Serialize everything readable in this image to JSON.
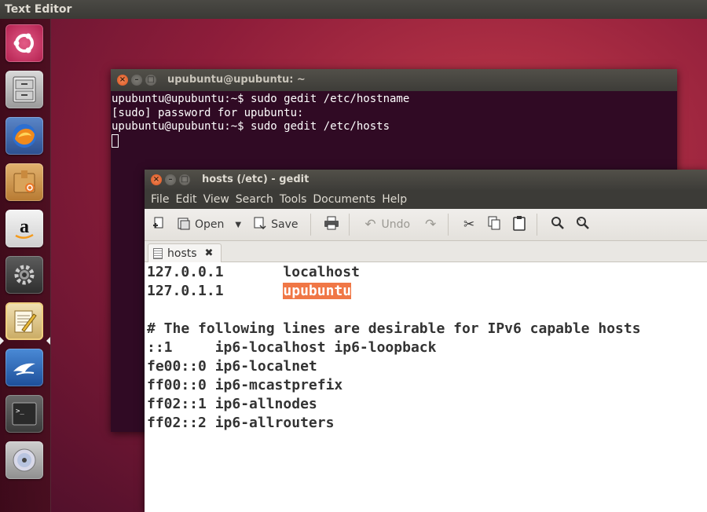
{
  "panel": {
    "title": "Text Editor"
  },
  "launcher": {
    "items": [
      {
        "name": "ubuntu-dash-icon"
      },
      {
        "name": "files-icon"
      },
      {
        "name": "firefox-icon"
      },
      {
        "name": "software-center-icon"
      },
      {
        "name": "amazon-icon"
      },
      {
        "name": "system-settings-icon"
      },
      {
        "name": "text-editor-icon"
      },
      {
        "name": "libreoffice-icon"
      },
      {
        "name": "terminal-icon"
      },
      {
        "name": "dvd-icon"
      }
    ]
  },
  "terminal": {
    "title": "upubuntu@upubuntu: ~",
    "lines": [
      "upubuntu@upubuntu:~$ sudo gedit /etc/hostname",
      "[sudo] password for upubuntu:",
      "upubuntu@upubuntu:~$ sudo gedit /etc/hosts"
    ]
  },
  "gedit": {
    "title": "hosts (/etc) - gedit",
    "menu": [
      "File",
      "Edit",
      "View",
      "Search",
      "Tools",
      "Documents",
      "Help"
    ],
    "toolbar": {
      "open": "Open",
      "save": "Save",
      "undo": "Undo"
    },
    "tab": {
      "label": "hosts",
      "close": "✖"
    },
    "lines": [
      {
        "a": "127.0.0.1       ",
        "b": "localhost"
      },
      {
        "a": "127.0.1.1       ",
        "b": "upubuntu"
      },
      {
        "a": "",
        "b": ""
      },
      {
        "a": "# The following lines are desirable for IPv6 capable hosts",
        "b": ""
      },
      {
        "a": "::1     ip6-localhost ip6-loopback",
        "b": ""
      },
      {
        "a": "fe00::0 ip6-localnet",
        "b": ""
      },
      {
        "a": "ff00::0 ip6-mcastprefix",
        "b": ""
      },
      {
        "a": "ff02::1 ip6-allnodes",
        "b": ""
      },
      {
        "a": "ff02::2 ip6-allrouters",
        "b": ""
      }
    ]
  }
}
